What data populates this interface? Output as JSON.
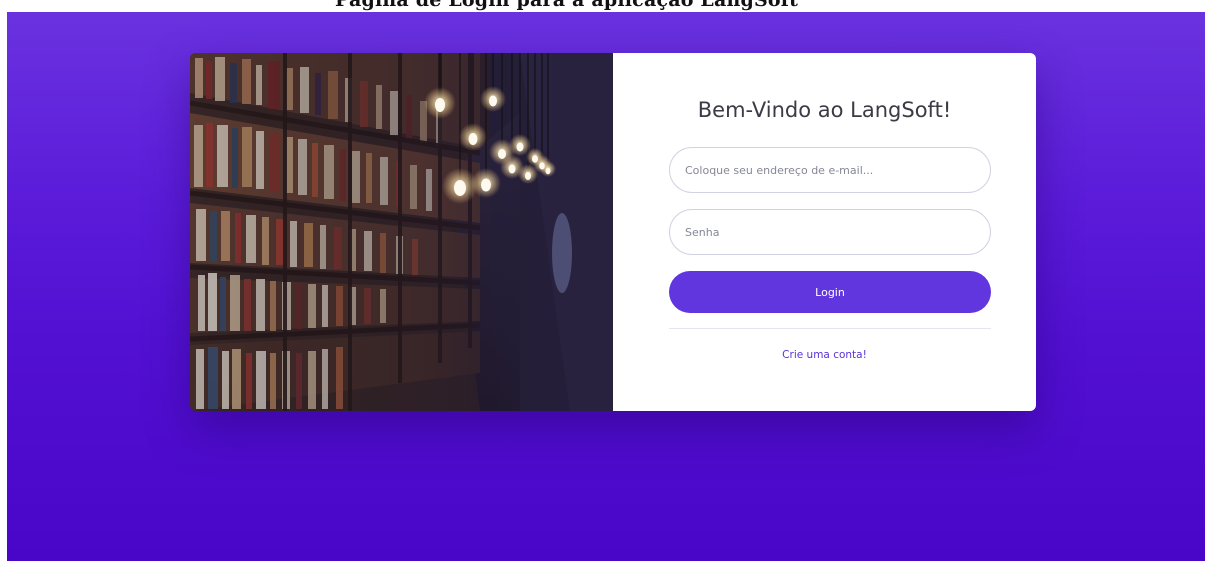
{
  "page": {
    "cutoff_heading": "Página de Login para a aplicação LangSoft"
  },
  "login": {
    "title": "Bem-Vindo ao LangSoft!",
    "email_placeholder": "Coloque seu endereço de e-mail...",
    "password_placeholder": "Senha",
    "login_button": "Login",
    "create_account_link": "Crie uma conta!"
  },
  "colors": {
    "background_top": "#6a32df",
    "background_bottom": "#4a06c8",
    "button": "#6236de",
    "link": "#5a32d8"
  },
  "icons": {
    "hero_image": "library-bookshelves-with-hanging-bulbs"
  }
}
